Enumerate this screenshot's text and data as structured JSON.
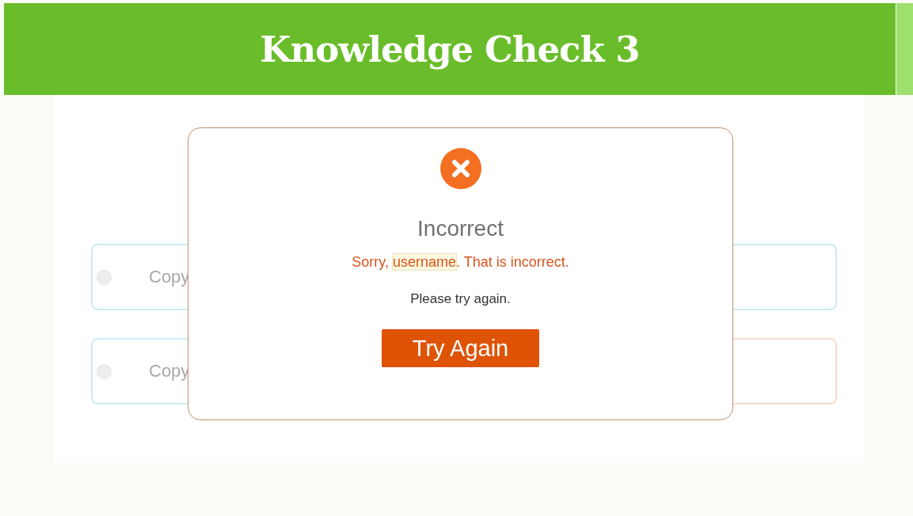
{
  "header": {
    "title": "Knowledge Check 3"
  },
  "options": [
    {
      "label": "Copy",
      "selected": false,
      "color": "#cdeaf0"
    },
    {
      "color": "#cdeaf0"
    },
    {
      "label": "Copy",
      "selected": false,
      "color": "#cdeaf0"
    },
    {
      "color": "#f8dccc"
    }
  ],
  "dialog": {
    "title": "Incorrect",
    "message": {
      "before": "Sorry, ",
      "highlight": "username",
      "after": ". That is incorrect."
    },
    "hint": "Please try again.",
    "button": "Try Again"
  }
}
